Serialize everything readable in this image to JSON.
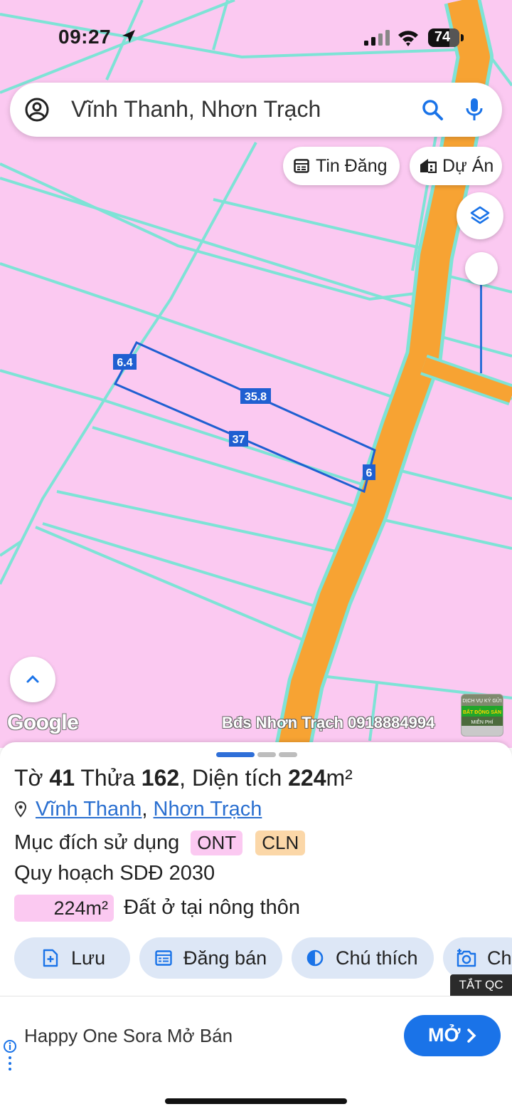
{
  "status_bar": {
    "time": "09:27",
    "battery": "74"
  },
  "search": {
    "query": "Vĩnh Thanh, Nhơn Trạch"
  },
  "chips": {
    "listings": "Tin Đăng",
    "projects": "Dự Án"
  },
  "map": {
    "edge_labels": [
      "6.4",
      "35.8",
      "37",
      "6"
    ],
    "google_logo": "Google",
    "watermark": "Bđs Nhơn Trạch 0918884994",
    "thumb_lines": [
      "DỊCH VỤ KÝ GỬI",
      "BẤT ĐỘNG SẢN",
      "MIỄN PHÍ"
    ],
    "colors": {
      "land": "#fbc9f1",
      "road": "#f7a333",
      "parcel_border": "#7ee3d6",
      "selection": "#1f5fd1"
    }
  },
  "parcel": {
    "title_prefix": "Tờ",
    "sheet_no": "41",
    "parcel_label": "Thửa",
    "parcel_no": "162",
    "area_label": ", Diện tích",
    "area_value": "224",
    "area_unit": "m²",
    "commune": "Vĩnh Thanh",
    "district": "Nhơn Trạch",
    "purpose_label": "Mục đích sử dụng",
    "purpose_tags": [
      "ONT",
      "CLN"
    ],
    "plan_label": "Quy hoạch SDĐ 2030",
    "plan_area": "224m²",
    "plan_desc": "Đất ở tại nông thôn"
  },
  "actions": {
    "save": "Lưu",
    "post": "Đăng bán",
    "legend": "Chú thích",
    "capture": "Ch"
  },
  "ad": {
    "hide_label": "TẮT QC",
    "text": "Happy One Sora Mở Bán",
    "open_button": "MỞ"
  }
}
